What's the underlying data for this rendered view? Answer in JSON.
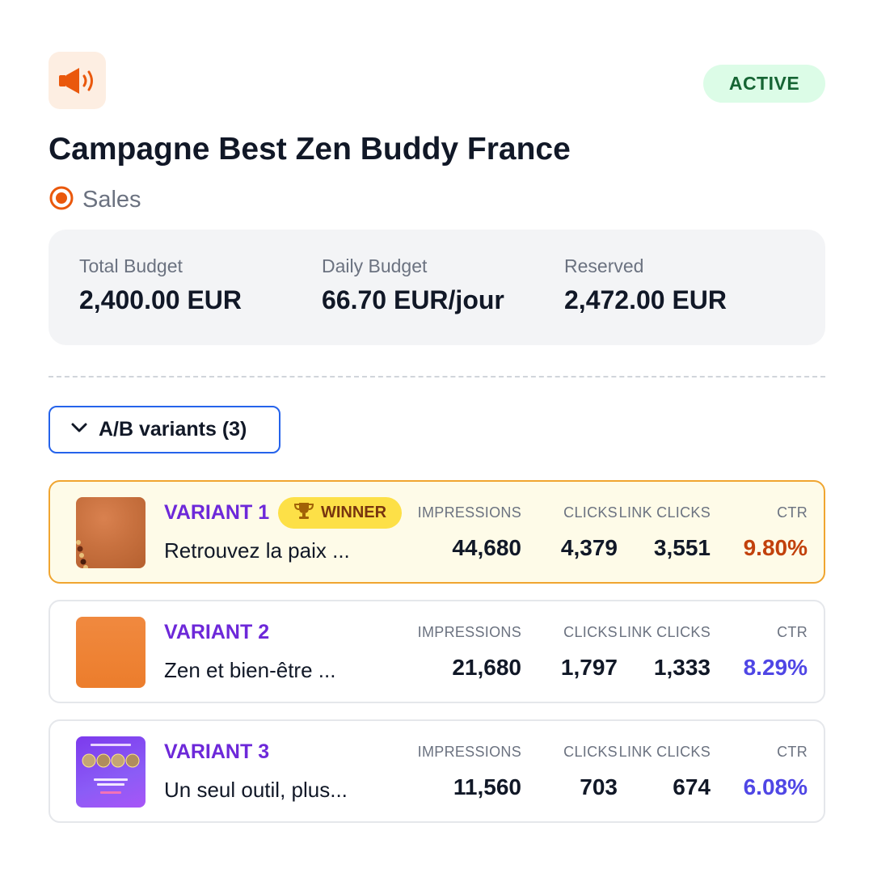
{
  "campaign": {
    "icon": "megaphone-icon",
    "status": "ACTIVE",
    "title": "Campagne Best Zen Buddy France",
    "objective_icon": "target-icon",
    "objective": "Sales"
  },
  "budget": {
    "total_label": "Total Budget",
    "total_value": "2,400.00 EUR",
    "daily_label": "Daily Budget",
    "daily_value": "66.70 EUR/jour",
    "reserved_label": "Reserved",
    "reserved_value": "2,472.00 EUR"
  },
  "variants_toggle": {
    "icon": "chevron-down-icon",
    "label": "A/B variants (3)"
  },
  "metric_labels": {
    "impressions": "IMPRESSIONS",
    "clicks": "CLICKS",
    "link_clicks": "LINK CLICKS",
    "ctr": "CTR"
  },
  "variants": [
    {
      "name": "VARIANT 1",
      "badge": "WINNER",
      "badge_icon": "trophy-icon",
      "text": "Retrouvez la paix ...",
      "impressions": "44,680",
      "clicks": "4,379",
      "link_clicks": "3,551",
      "ctr": "9.80%"
    },
    {
      "name": "VARIANT 2",
      "text": "Zen et bien-être ...",
      "impressions": "21,680",
      "clicks": "1,797",
      "link_clicks": "1,333",
      "ctr": "8.29%"
    },
    {
      "name": "VARIANT 3",
      "text": "Un seul outil, plus...",
      "impressions": "11,560",
      "clicks": "703",
      "link_clicks": "674",
      "ctr": "6.08%"
    }
  ],
  "colors": {
    "accent": "#6d28d9",
    "winner_ctr": "#c2410c",
    "ctr": "#4f46e5",
    "status_bg": "#dcfce7",
    "status_text": "#166534",
    "focus_border": "#2563eb"
  }
}
